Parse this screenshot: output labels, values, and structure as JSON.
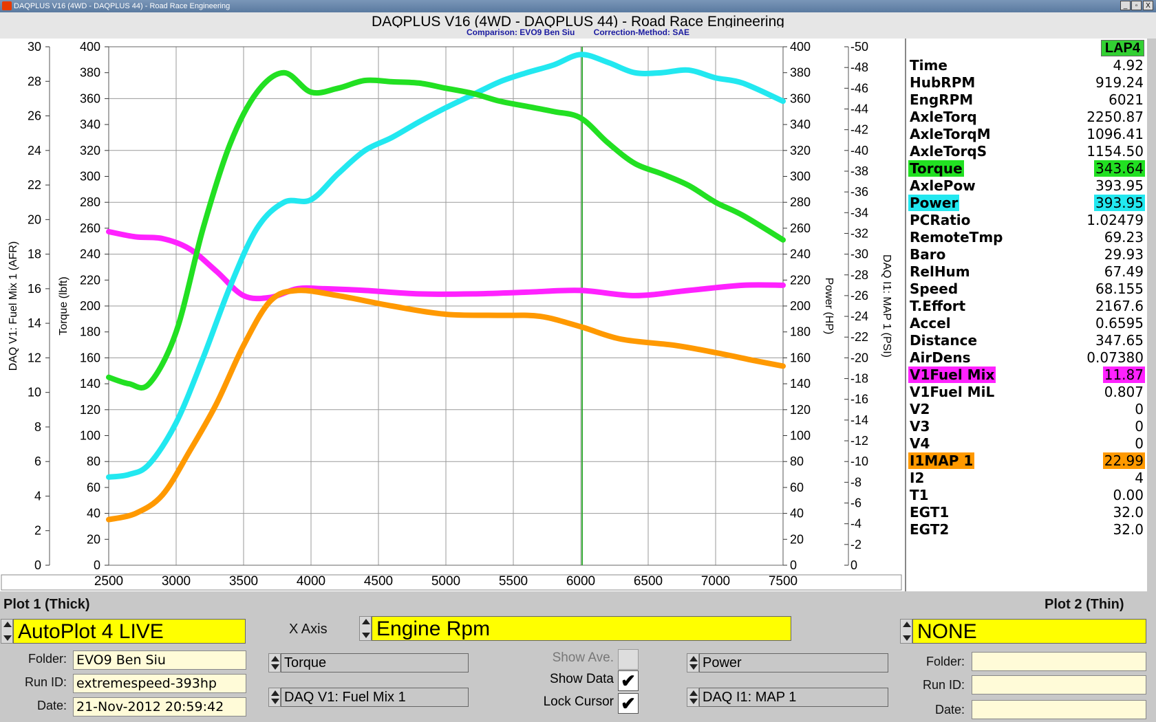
{
  "window": {
    "title": "DAQPLUS V16 (4WD - DAQPLUS 44) - Road Race Engineering",
    "buttons": [
      "_",
      "▫",
      "X"
    ]
  },
  "header": {
    "title": "DAQPLUS V16 (4WD - DAQPLUS 44) - Road Race Engineering",
    "comparison": "Comparison: EVO9 Ben Siu",
    "correction": "Correction-Method: SAE"
  },
  "colors": {
    "torque": "#22e022",
    "power": "#22e8f0",
    "fuel": "#ff22ff",
    "map": "#ff9900"
  },
  "chart_data": {
    "type": "line",
    "x_axis": {
      "ticks": [
        2500,
        3000,
        3500,
        4000,
        4500,
        5000,
        5500,
        6000,
        6500,
        7000,
        7500
      ],
      "range": [
        2500,
        7500
      ]
    },
    "axes": {
      "left_outer": {
        "label": "DAQ V1: Fuel Mix 1 (AFR)",
        "ticks": [
          0,
          2,
          4,
          6,
          8,
          10,
          12,
          14,
          16,
          18,
          20,
          22,
          24,
          26,
          28,
          30
        ],
        "range": [
          0,
          30
        ]
      },
      "left_inner": {
        "label": "Torque (lbft)",
        "ticks": [
          0,
          20,
          40,
          60,
          80,
          100,
          120,
          140,
          160,
          180,
          200,
          220,
          240,
          260,
          280,
          300,
          320,
          340,
          360,
          380,
          400
        ],
        "range": [
          0,
          400
        ]
      },
      "right_inner": {
        "label": "Power (HP)",
        "ticks": [
          0,
          20,
          40,
          60,
          80,
          100,
          120,
          140,
          160,
          180,
          200,
          220,
          240,
          260,
          280,
          300,
          320,
          340,
          360,
          380,
          400
        ],
        "range": [
          0,
          400
        ]
      },
      "right_outer": {
        "label": "DAQ I1: MAP 1 (PSI)",
        "ticks": [
          0,
          -2,
          -4,
          -6,
          -8,
          -10,
          -12,
          -14,
          -16,
          -18,
          -20,
          -22,
          -24,
          -26,
          -28,
          -30,
          -32,
          -34,
          -36,
          -38,
          -40,
          -42,
          -44,
          -46,
          -48,
          -50
        ],
        "range": [
          0,
          -50
        ]
      }
    },
    "cursor_x": 6010,
    "series": [
      {
        "name": "Torque",
        "axis": "left_inner",
        "x": [
          2500,
          2650,
          2800,
          3000,
          3200,
          3400,
          3600,
          3800,
          4000,
          4200,
          4400,
          4600,
          4800,
          5000,
          5200,
          5400,
          5600,
          5800,
          6000,
          6200,
          6400,
          6600,
          6800,
          7000,
          7200,
          7500
        ],
        "y": [
          145,
          140,
          140,
          180,
          260,
          325,
          365,
          380,
          365,
          368,
          374,
          373,
          372,
          368,
          364,
          358,
          354,
          350,
          345,
          326,
          310,
          302,
          293,
          280,
          270,
          251
        ]
      },
      {
        "name": "Power",
        "axis": "right_inner",
        "x": [
          2500,
          2650,
          2800,
          3000,
          3200,
          3400,
          3600,
          3800,
          4000,
          4200,
          4400,
          4600,
          4800,
          5000,
          5200,
          5400,
          5600,
          5800,
          6000,
          6200,
          6400,
          6600,
          6800,
          7000,
          7200,
          7500
        ],
        "y": [
          68,
          70,
          78,
          110,
          160,
          215,
          260,
          280,
          282,
          302,
          320,
          330,
          342,
          353,
          363,
          373,
          380,
          386,
          394,
          388,
          380,
          380,
          382,
          376,
          372,
          358
        ]
      },
      {
        "name": "DAQ V1: Fuel Mix 1",
        "axis": "left_outer",
        "x": [
          2500,
          2700,
          2900,
          3100,
          3300,
          3500,
          3700,
          3900,
          4100,
          4400,
          4800,
          5200,
          5600,
          6000,
          6400,
          6800,
          7200,
          7500
        ],
        "y": [
          19.3,
          19.0,
          18.9,
          18.3,
          17.0,
          15.6,
          15.5,
          16.0,
          16.0,
          15.9,
          15.7,
          15.7,
          15.8,
          15.9,
          15.6,
          15.9,
          16.2,
          16.2
        ]
      },
      {
        "name": "DAQ I1: MAP 1",
        "axis": "right_outer",
        "x": [
          2500,
          2700,
          2900,
          3100,
          3300,
          3500,
          3700,
          3900,
          4200,
          4600,
          5000,
          5400,
          5700,
          6000,
          6300,
          6700,
          7000,
          7300,
          7500
        ],
        "y": [
          -4.4,
          -5.0,
          -6.8,
          -11.0,
          -15.6,
          -21.2,
          -25.5,
          -26.5,
          -26.0,
          -25.0,
          -24.2,
          -24.1,
          -24.0,
          -23.0,
          -21.8,
          -21.2,
          -20.5,
          -19.7,
          -19.2
        ]
      }
    ]
  },
  "readouts": {
    "header": "LAP4",
    "rows": [
      {
        "label": "Time",
        "value": "4.92"
      },
      {
        "label": "HubRPM",
        "value": "919.24"
      },
      {
        "label": "EngRPM",
        "value": "6021"
      },
      {
        "label": "AxleTorq",
        "value": "2250.87"
      },
      {
        "label": "AxleTorqM",
        "value": "1096.41"
      },
      {
        "label": "AxleTorqS",
        "value": "1154.50"
      },
      {
        "label": "Torque",
        "value": "343.64",
        "color": "#22e022"
      },
      {
        "label": "AxlePow",
        "value": "393.95"
      },
      {
        "label": "Power",
        "value": "393.95",
        "color": "#22e8f0"
      },
      {
        "label": "PCRatio",
        "value": "1.02479"
      },
      {
        "label": "RemoteTmp",
        "value": "69.23"
      },
      {
        "label": "Baro",
        "value": "29.93"
      },
      {
        "label": "RelHum",
        "value": "67.49"
      },
      {
        "label": "Speed",
        "value": "68.155"
      },
      {
        "label": "T.Effort",
        "value": "2167.6"
      },
      {
        "label": "Accel",
        "value": "0.6595"
      },
      {
        "label": "Distance",
        "value": "347.65"
      },
      {
        "label": "AirDens",
        "value": "0.07380"
      },
      {
        "label": "V1Fuel Mix",
        "value": "11.87",
        "color": "#ff22ff"
      },
      {
        "label": "V1Fuel MiL",
        "value": "0.807"
      },
      {
        "label": "V2",
        "value": "0"
      },
      {
        "label": "V3",
        "value": "0"
      },
      {
        "label": "V4",
        "value": "0"
      },
      {
        "label": "I1MAP 1",
        "value": "22.99",
        "color": "#ff9900"
      },
      {
        "label": "I2",
        "value": "4"
      },
      {
        "label": "T1",
        "value": "0.00"
      },
      {
        "label": "EGT1",
        "value": "32.0"
      },
      {
        "label": "EGT2",
        "value": "32.0"
      }
    ]
  },
  "controls": {
    "plot1_label": "Plot 1 (Thick)",
    "plot2_label": "Plot 2 (Thin)",
    "plot1_select": "AutoPlot 4 LIVE",
    "plot2_select": "NONE",
    "x_axis_label": "X Axis",
    "x_axis_value": "Engine Rpm",
    "folder_label": "Folder:",
    "runid_label": "Run ID:",
    "date_label": "Date:",
    "folder_value": "EVO9 Ben Siu",
    "runid_value": "extremespeed-393hp",
    "date_value": "21-Nov-2012 20:59:42",
    "channel_torque": "Torque",
    "channel_power": "Power",
    "channel_fuel": "DAQ V1: Fuel Mix 1",
    "channel_map": "DAQ I1: MAP 1",
    "show_ave": "Show Ave.",
    "show_data": "Show Data",
    "lock_cursor": "Lock Cursor",
    "check_mark": "✔"
  }
}
